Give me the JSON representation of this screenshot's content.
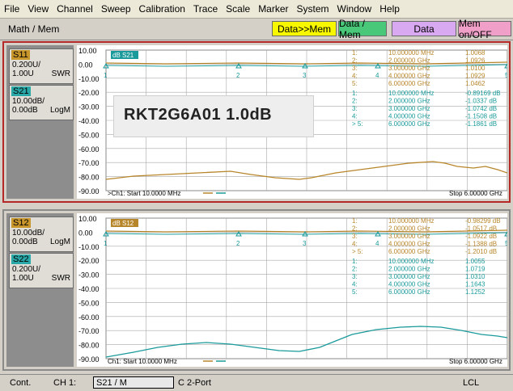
{
  "menu": [
    "File",
    "View",
    "Channel",
    "Sweep",
    "Calibration",
    "Trace",
    "Scale",
    "Marker",
    "System",
    "Window",
    "Help"
  ],
  "softkeys": {
    "title": "Math / Mem",
    "buttons": [
      {
        "label": "Data>>Mem",
        "bg": "#f7f700"
      },
      {
        "label": "Data / Mem",
        "bg": "#48c878"
      },
      {
        "label": "Data",
        "bg": "#d8a8f0"
      },
      {
        "label": "Mem on/OFF",
        "bg": "#f0a0c8"
      }
    ]
  },
  "overlay": {
    "text": "RKT2G6A01   1.0dB"
  },
  "colors": {
    "gold": "#b8862a",
    "teal": "#1a9a9a",
    "grid": "#a8a8a8"
  },
  "channels": [
    {
      "traces": [
        {
          "name": "S11",
          "name_bg": "#c8962a",
          "scale": "0.200U/",
          "ref": "1.00U",
          "fmt": "SWR"
        },
        {
          "name": "S21",
          "name_bg": "#2aa8a8",
          "scale": "10.00dB/",
          "ref": "0.00dB",
          "fmt": "LogM"
        }
      ],
      "y_labels": [
        "10.00",
        "0.00",
        "-10.00",
        "-20.00",
        "-30.00",
        "-40.00",
        "-50.00",
        "-60.00",
        "-70.00",
        "-80.00",
        "-90.00"
      ],
      "trace_tag": "dB S21",
      "footer_left": ">Ch1: Start  10.0000 MHz",
      "footer_right": "Stop  6.00000 GHz",
      "markers_a": [
        {
          "n": "1:",
          "f": "10.000000 MHz",
          "v": "1.0068"
        },
        {
          "n": "2:",
          "f": "2.000000 GHz",
          "v": "1.0926"
        },
        {
          "n": "3:",
          "f": "3.000000 GHz",
          "v": "1.0100"
        },
        {
          "n": "4:",
          "f": "4.000000 GHz",
          "v": "1.0929"
        },
        {
          "n": "5:",
          "f": "6.000000 GHz",
          "v": "1.0462"
        }
      ],
      "markers_b": [
        {
          "n": "1:",
          "f": "10.000000 MHz",
          "v": "-0.89169 dB"
        },
        {
          "n": "2:",
          "f": "2.000000 GHz",
          "v": "-1.0337 dB"
        },
        {
          "n": "3:",
          "f": "3.000000 GHz",
          "v": "-1.0742 dB"
        },
        {
          "n": "4:",
          "f": "4.000000 GHz",
          "v": "-1.1508 dB"
        },
        {
          "n": "> 5:",
          "f": "6.000000 GHz",
          "v": "-1.1861 dB"
        }
      ]
    },
    {
      "traces": [
        {
          "name": "S12",
          "name_bg": "#c8962a",
          "scale": "10.00dB/",
          "ref": "0.00dB",
          "fmt": "LogM"
        },
        {
          "name": "S22",
          "name_bg": "#2aa8a8",
          "scale": "0.200U/",
          "ref": "1.00U",
          "fmt": "SWR"
        }
      ],
      "y_labels": [
        "10.00",
        "0.00",
        "-10.00",
        "-20.00",
        "-30.00",
        "-40.00",
        "-50.00",
        "-60.00",
        "-70.00",
        "-80.00",
        "-90.00"
      ],
      "trace_tag": "dB S12",
      "footer_left": "Ch1: Start  10.0000 MHz",
      "footer_right": "Stop  6.00000 GHz",
      "markers_a": [
        {
          "n": "1:",
          "f": "10.000000 MHz",
          "v": "-0.98299 dB"
        },
        {
          "n": "2:",
          "f": "2.000000 GHz",
          "v": "-1.0517 dB"
        },
        {
          "n": "3:",
          "f": "3.000000 GHz",
          "v": "-1.0922 dB"
        },
        {
          "n": "4:",
          "f": "4.000000 GHz",
          "v": "-1.1388 dB"
        },
        {
          "n": "> 5:",
          "f": "6.000000 GHz",
          "v": "-1.2010 dB"
        }
      ],
      "markers_b": [
        {
          "n": "1:",
          "f": "10.000000 MHz",
          "v": "1.0055"
        },
        {
          "n": "2:",
          "f": "2.000000 GHz",
          "v": "1.0719"
        },
        {
          "n": "3:",
          "f": "3.000000 GHz",
          "v": "1.0310"
        },
        {
          "n": "4:",
          "f": "4.000000 GHz",
          "v": "1.1643"
        },
        {
          "n": "5:",
          "f": "6.000000 GHz",
          "v": "1.1252"
        }
      ]
    }
  ],
  "status": {
    "mode": "Cont.",
    "channel": "CH 1:",
    "trace": "S21 / M",
    "cal": "C  2-Port",
    "lcl": "LCL"
  }
}
